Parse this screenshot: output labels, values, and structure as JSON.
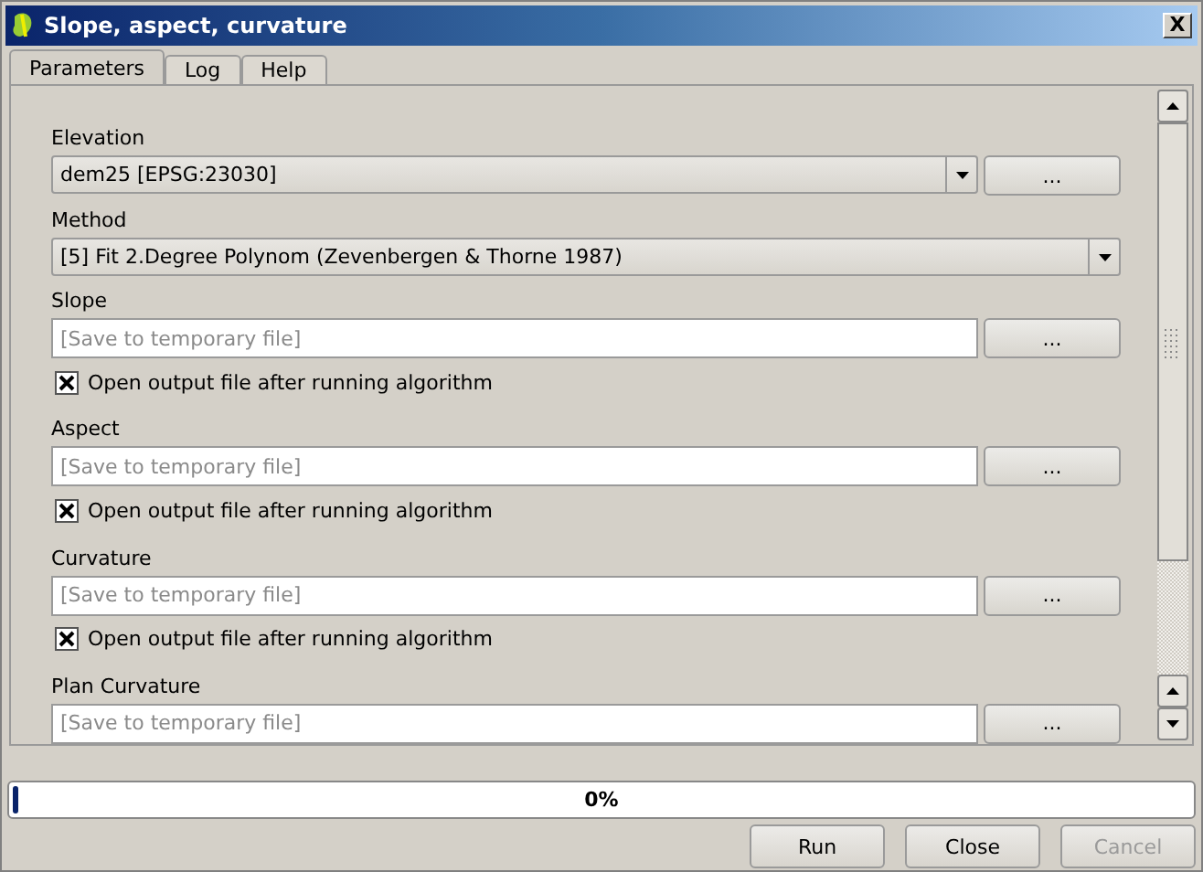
{
  "window": {
    "title": "Slope, aspect, curvature",
    "close": "X"
  },
  "tabs": [
    {
      "label": "Parameters",
      "selected": true
    },
    {
      "label": "Log",
      "selected": false
    },
    {
      "label": "Help",
      "selected": false
    }
  ],
  "params": [
    {
      "kind": "combo",
      "label": "Elevation",
      "value": "dem25 [EPSG:23030]",
      "browse": "..."
    },
    {
      "kind": "combo",
      "label": "Method",
      "value": "[5] Fit 2.Degree Polynom (Zevenbergen & Thorne 1987)"
    },
    {
      "kind": "output",
      "label": "Slope",
      "placeholder": "[Save to temporary file]",
      "browse": "...",
      "open_output": {
        "label": "Open output file after running algorithm",
        "checked": true
      }
    },
    {
      "kind": "output",
      "label": "Aspect",
      "placeholder": "[Save to temporary file]",
      "browse": "...",
      "open_output": {
        "label": "Open output file after running algorithm",
        "checked": true
      }
    },
    {
      "kind": "output",
      "label": "Curvature",
      "placeholder": "[Save to temporary file]",
      "browse": "...",
      "open_output": {
        "label": "Open output file after running algorithm",
        "checked": true
      }
    },
    {
      "kind": "output",
      "label": "Plan Curvature",
      "placeholder": "[Save to temporary file]",
      "browse": "..."
    }
  ],
  "progress": {
    "level": 0,
    "text": "0%"
  },
  "buttons": [
    {
      "label": "Run",
      "disabled": false
    },
    {
      "label": "Close",
      "disabled": false
    },
    {
      "label": "Cancel",
      "disabled": true
    }
  ]
}
